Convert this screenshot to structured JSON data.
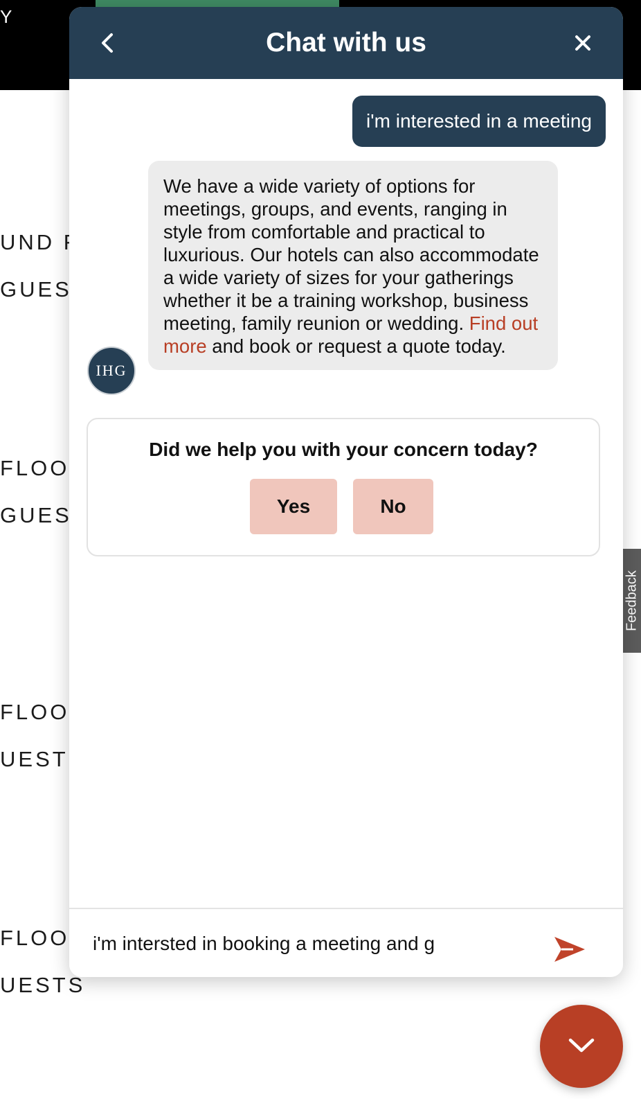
{
  "background": {
    "corner_text": "Y",
    "labels": [
      "UND F",
      "GUEST",
      "FLOO",
      "GUEST",
      "FLOO",
      "UESTS",
      "FLOO",
      "UESTS"
    ],
    "feedback_tab": "Feedback"
  },
  "chat": {
    "header": {
      "title": "Chat with us",
      "back_icon": "chevron-left-icon",
      "close_icon": "close-icon"
    },
    "messages": [
      {
        "from": "user",
        "text": "i'm interested in a meeting"
      },
      {
        "from": "bot",
        "avatar": "IHG",
        "text_before_link": "We have a wide variety of options for meetings, groups, and events, ranging in style from comfortable and practical to luxurious. Our hotels can also accommodate a wide variety of sizes for your gatherings whether it be a training workshop, business meeting, family reunion or wedding. ",
        "link_text": "Find out more",
        "text_after_link": " and book or request a quote today."
      }
    ],
    "survey": {
      "question": "Did we help you with your concern today?",
      "yes_label": "Yes",
      "no_label": "No"
    },
    "composer": {
      "value": "i'm intersted in booking a meeting and g",
      "send_icon": "send-icon"
    }
  },
  "fab": {
    "icon": "chevron-down-icon"
  },
  "colors": {
    "header": "#263f54",
    "accent": "#b83f25",
    "survey_button": "#f0c6bc",
    "bot_bubble": "#ececec"
  }
}
